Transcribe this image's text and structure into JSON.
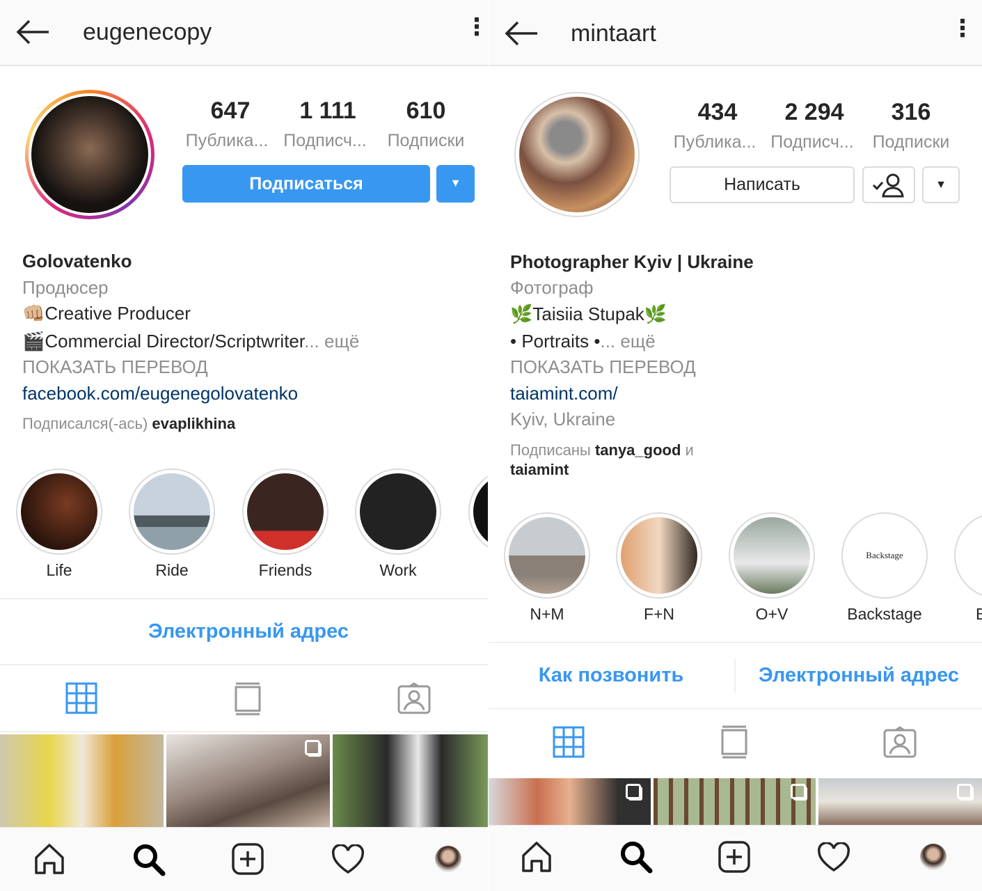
{
  "left": {
    "username": "eugenecopy",
    "stats": [
      {
        "value": "647",
        "label": "Публика..."
      },
      {
        "value": "1 111",
        "label": "Подписч..."
      },
      {
        "value": "610",
        "label": "Подписки"
      }
    ],
    "follow_label": "Подписаться",
    "name": "Golovatenko",
    "category": "Продюсер",
    "bio": [
      "👊🏼Creative Producer",
      "🎬Commercial Director/Scriptwriter"
    ],
    "more": "... ещё",
    "translate": "ПОКАЗАТЬ ПЕРЕВОД",
    "website": "facebook.com/eugenegolovatenko",
    "followed_by_prefix": "Подписался(-ась)",
    "followed_by_user": "evaplikhina",
    "highlights": [
      "Life",
      "Ride",
      "Friends",
      "Work"
    ],
    "contact": "Электронный адрес"
  },
  "right": {
    "username": "mintaart",
    "stats": [
      {
        "value": "434",
        "label": "Публика..."
      },
      {
        "value": "2 294",
        "label": "Подписч..."
      },
      {
        "value": "316",
        "label": "Подписки"
      }
    ],
    "message_label": "Написать",
    "name": "Photographer Kyiv | Ukraine",
    "category": "Фотограф",
    "bio": [
      "🌿Taisiia Stupak🌿",
      "• Portraits •"
    ],
    "more": "... ещё",
    "translate": "ПОКАЗАТЬ ПЕРЕВОД",
    "website": "taiamint.com/",
    "location": "Kyiv, Ukraine",
    "followed_by_prefix": "Подписаны",
    "followed_by_user1": "tanya_good",
    "followed_by_and": "и",
    "followed_by_user2": "taiamint",
    "highlights": [
      "N+M",
      "F+N",
      "O+V",
      "Backstage",
      "B"
    ],
    "highlight_cover_text": "Backstage",
    "contacts": [
      "Как позвонить",
      "Электронный адрес"
    ]
  },
  "colors": {
    "accent": "#3897f0",
    "link": "#003569",
    "muted": "#8e8e8e"
  }
}
